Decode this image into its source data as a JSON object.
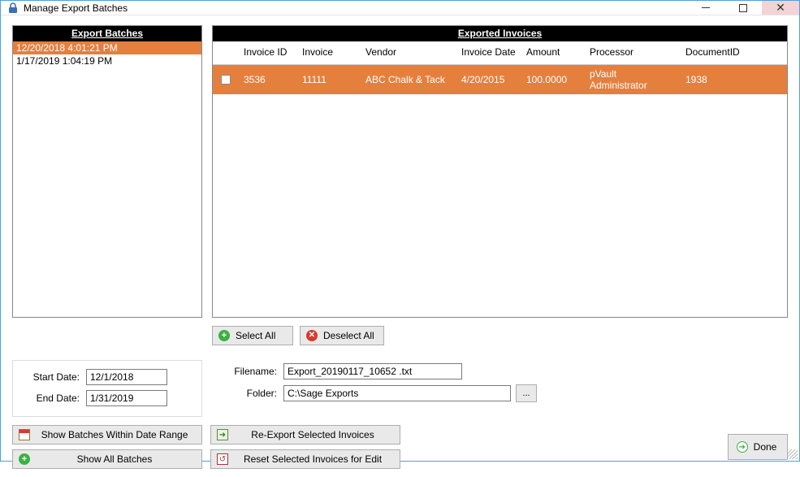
{
  "window": {
    "title": "Manage Export Batches",
    "icon": "lock-icon"
  },
  "panels": {
    "batches_header": "Export Batches",
    "invoices_header": "Exported Invoices"
  },
  "batches": [
    {
      "label": "12/20/2018 4:01:21 PM",
      "selected": true
    },
    {
      "label": "1/17/2019 1:04:19 PM",
      "selected": false
    }
  ],
  "invoice_columns": {
    "checkbox": "",
    "invoice_id": "Invoice ID",
    "invoice": "Invoice",
    "vendor": "Vendor",
    "invoice_date": "Invoice Date",
    "amount": "Amount",
    "processor": "Processor",
    "document_id": "DocumentID"
  },
  "invoices": [
    {
      "checked": false,
      "invoice_id": "3536",
      "invoice": "11111",
      "vendor": "ABC Chalk & Tack",
      "invoice_date": "4/20/2015",
      "amount": "100.0000",
      "processor": "pVault Administrator",
      "document_id": "1938"
    }
  ],
  "buttons": {
    "select_all": "Select All",
    "deselect_all": "Deselect All",
    "show_range": "Show Batches Within Date Range",
    "show_all": "Show All Batches",
    "reexport": "Re-Export Selected Invoices",
    "reset": "Reset Selected Invoices for Edit",
    "done": "Done",
    "browse": "..."
  },
  "dates": {
    "start_label": "Start Date:",
    "end_label": "End Date:",
    "start_value": "12/1/2018",
    "end_value": "1/31/2019"
  },
  "file": {
    "filename_label": "Filename:",
    "folder_label": "Folder:",
    "filename_value": "Export_20190117_10652 .txt",
    "folder_value": "C:\\Sage Exports"
  }
}
